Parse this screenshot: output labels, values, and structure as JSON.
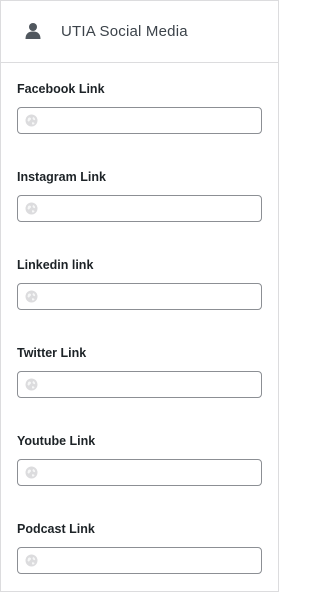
{
  "header": {
    "title": "UTIA Social Media",
    "icon": "user-icon"
  },
  "fields": [
    {
      "label": "Facebook Link",
      "value": "",
      "icon": "globe-icon"
    },
    {
      "label": "Instagram Link",
      "value": "",
      "icon": "globe-icon"
    },
    {
      "label": "Linkedin link",
      "value": "",
      "icon": "globe-icon"
    },
    {
      "label": "Twitter Link",
      "value": "",
      "icon": "globe-icon"
    },
    {
      "label": "Youtube Link",
      "value": "",
      "icon": "globe-icon"
    },
    {
      "label": "Podcast Link",
      "value": "",
      "icon": "globe-icon"
    }
  ],
  "colors": {
    "border": "#dcdcde",
    "input_border": "#8c8f94",
    "title_text": "#3c434a",
    "label_text": "#1d2327",
    "icon_gray": "#c3c4c7"
  }
}
